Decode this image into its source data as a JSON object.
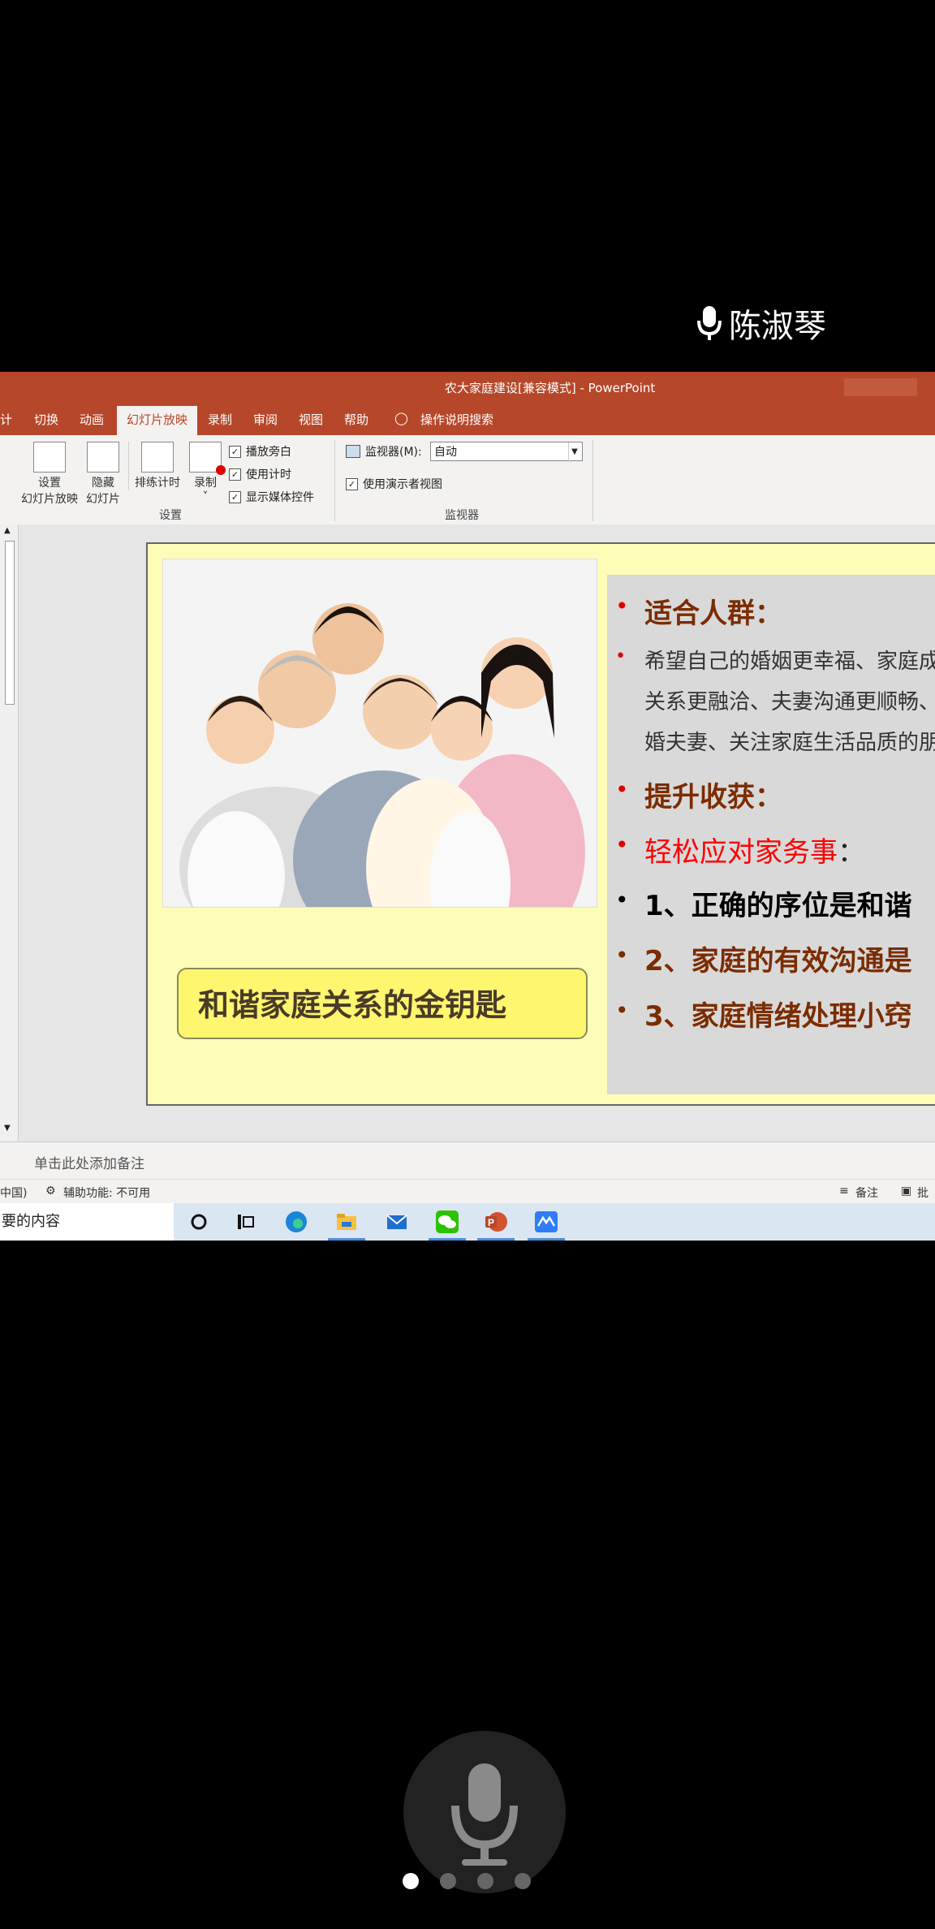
{
  "speaker": {
    "name": "陈淑琴"
  },
  "window": {
    "title": "农大家庭建设[兼容模式]  -  PowerPoint"
  },
  "tabs": [
    "计",
    "切换",
    "动画",
    "幻灯片放映",
    "录制",
    "审阅",
    "视图",
    "帮助"
  ],
  "tab_active": "幻灯片放映",
  "tell_me": "操作说明搜索",
  "ribbon": {
    "setup_button": [
      "设置",
      "幻灯片放映"
    ],
    "hide_button": [
      "隐藏",
      "幻灯片"
    ],
    "rehearse_button": "排练计时",
    "record_button": "录制",
    "checkboxes": [
      "播放旁白",
      "使用计时",
      "显示媒体控件"
    ],
    "group_setup": "设置",
    "monitor_label": "监视器(M):",
    "monitor_value": "自动",
    "presenter_view": "使用演示者视图",
    "group_monitor": "监视器"
  },
  "slide": {
    "caption": "和谐家庭关系的金钥匙",
    "lines": [
      {
        "text": "适合人群：",
        "color": "#7b2c00"
      },
      {
        "text": "希望自己的婚姻更幸福、家庭成",
        "color": "#333333"
      },
      {
        "text": "关系更融洽、夫妻沟通更顺畅、",
        "color": "#333333"
      },
      {
        "text": "婚夫妻、关注家庭生活品质的朋",
        "color": "#333333"
      },
      {
        "text": "提升收获：",
        "color": "#7b2c00"
      },
      {
        "text": "轻松应对家务事",
        "suffix": "：",
        "color": "#ff0000"
      },
      {
        "text": "1、正确的序位是和谐",
        "color": "#000000"
      },
      {
        "text": "2、家庭的有效沟通是",
        "color": "#7b2c00"
      },
      {
        "text": "3、家庭情绪处理小窍",
        "color": "#7b2c00"
      }
    ]
  },
  "notes": {
    "placeholder": "单击此处添加备注"
  },
  "status": {
    "language": "中国)",
    "accessibility": "辅助功能: 不可用",
    "notes_btn": "备注",
    "comments_btn": "批注"
  },
  "taskbar": {
    "search_text": "要的内容"
  },
  "page_dots": 4,
  "colors": {
    "accent": "#b7472a",
    "slide_bg": "#fefdb8",
    "bullet": "#e00000"
  }
}
